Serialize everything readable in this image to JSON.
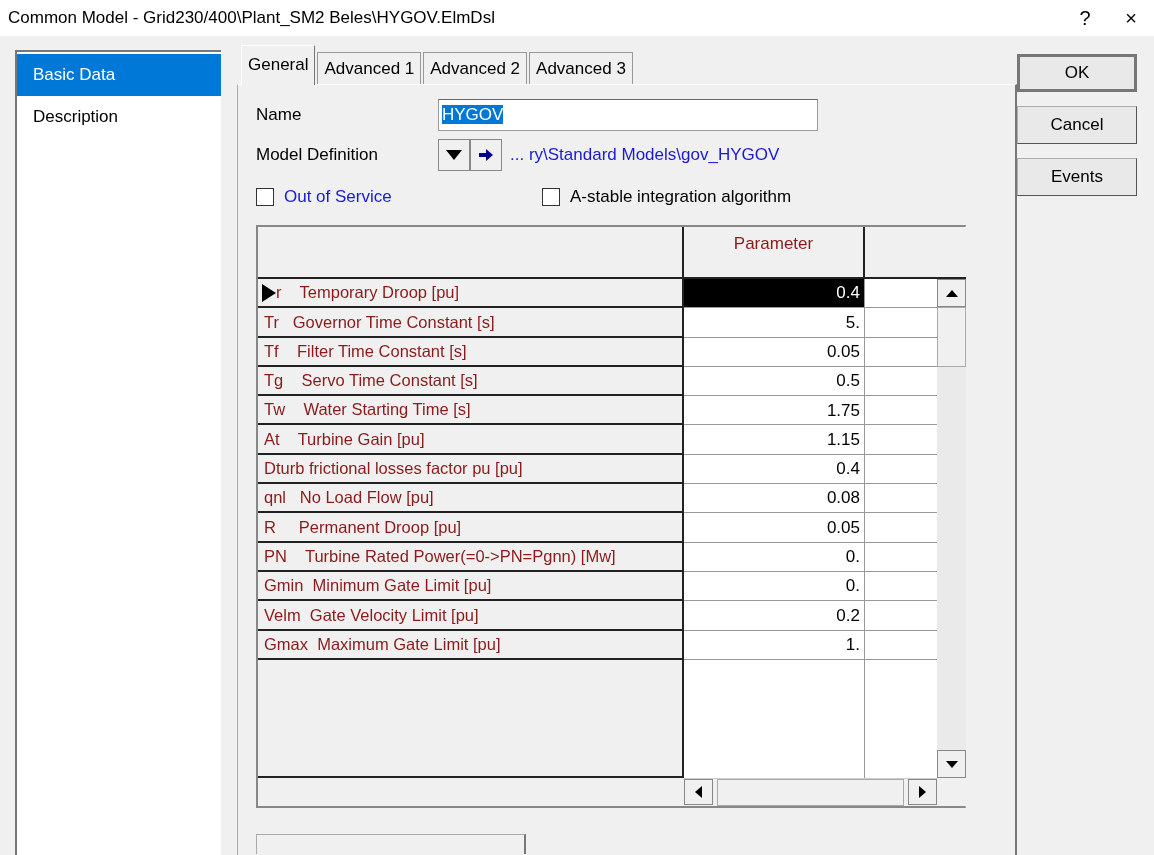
{
  "window": {
    "title": "Common Model - Grid230/400\\Plant_SM2 Beles\\HYGOV.ElmDsl",
    "help": "?",
    "close": "×"
  },
  "sidebar": {
    "items": [
      {
        "label": "Basic Data",
        "selected": true
      },
      {
        "label": "Description",
        "selected": false
      }
    ]
  },
  "tabs": [
    {
      "label": "General",
      "selected": true
    },
    {
      "label": "Advanced 1",
      "selected": false
    },
    {
      "label": "Advanced 2",
      "selected": false
    },
    {
      "label": "Advanced 3",
      "selected": false
    }
  ],
  "form": {
    "name_label": "Name",
    "name_value": "HYGOV",
    "model_definition_label": "Model Definition",
    "model_definition_value": "... ry\\Standard Models\\gov_HYGOV",
    "out_of_service": {
      "label": "Out of Service",
      "checked": false
    },
    "a_stable": {
      "label": "A-stable integration algorithm",
      "checked": false
    }
  },
  "table": {
    "columns": [
      "Parameter"
    ],
    "rows": [
      {
        "label": "r    Temporary Droop [pu]",
        "value": "0.4",
        "selected": true
      },
      {
        "label": "Tr   Governor Time Constant [s]",
        "value": "5.",
        "selected": false
      },
      {
        "label": "Tf    Filter Time Constant [s]",
        "value": "0.05",
        "selected": false
      },
      {
        "label": "Tg    Servo Time Constant [s]",
        "value": "0.5",
        "selected": false
      },
      {
        "label": "Tw    Water Starting Time [s]",
        "value": "1.75",
        "selected": false
      },
      {
        "label": "At    Turbine Gain [pu]",
        "value": "1.15",
        "selected": false
      },
      {
        "label": "Dturb frictional losses factor pu [pu]",
        "value": "0.4",
        "selected": false
      },
      {
        "label": "qnl   No Load Flow [pu]",
        "value": "0.08",
        "selected": false
      },
      {
        "label": "R     Permanent Droop [pu]",
        "value": "0.05",
        "selected": false
      },
      {
        "label": "PN    Turbine Rated Power(=0->PN=Pgnn) [Mw]",
        "value": "0.",
        "selected": false
      },
      {
        "label": "Gmin  Minimum Gate Limit [pu]",
        "value": "0.",
        "selected": false
      },
      {
        "label": "Velm  Gate Velocity Limit [pu]",
        "value": "0.2",
        "selected": false
      },
      {
        "label": "Gmax  Maximum Gate Limit [pu]",
        "value": "1.",
        "selected": false
      }
    ]
  },
  "buttons": [
    "OK",
    "Cancel",
    "Events"
  ]
}
